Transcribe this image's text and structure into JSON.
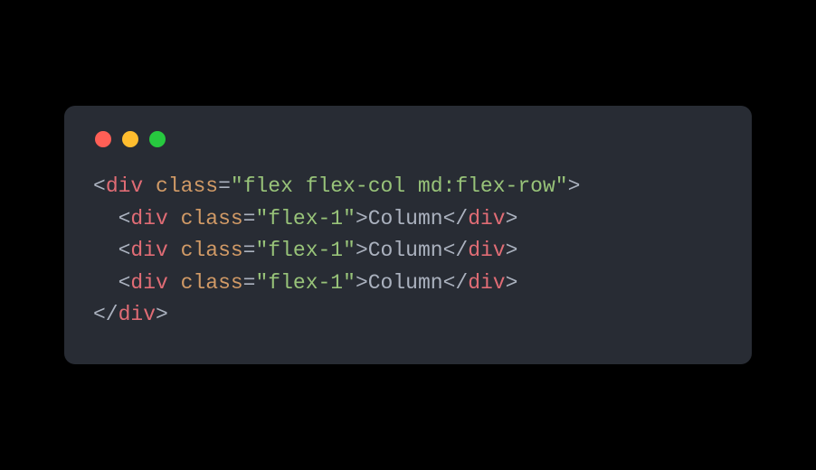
{
  "code": {
    "lines": [
      {
        "indent": "",
        "open": {
          "lt": "<",
          "tag": "div",
          "sp": " ",
          "attr": "class",
          "eq": "=",
          "q1": "\"",
          "val": "flex flex-col md:flex-row",
          "q2": "\"",
          "gt": ">"
        },
        "text": "",
        "close": null
      },
      {
        "indent": "  ",
        "open": {
          "lt": "<",
          "tag": "div",
          "sp": " ",
          "attr": "class",
          "eq": "=",
          "q1": "\"",
          "val": "flex-1",
          "q2": "\"",
          "gt": ">"
        },
        "text": "Column",
        "close": {
          "lt": "</",
          "tag": "div",
          "gt": ">"
        }
      },
      {
        "indent": "  ",
        "open": {
          "lt": "<",
          "tag": "div",
          "sp": " ",
          "attr": "class",
          "eq": "=",
          "q1": "\"",
          "val": "flex-1",
          "q2": "\"",
          "gt": ">"
        },
        "text": "Column",
        "close": {
          "lt": "</",
          "tag": "div",
          "gt": ">"
        }
      },
      {
        "indent": "  ",
        "open": {
          "lt": "<",
          "tag": "div",
          "sp": " ",
          "attr": "class",
          "eq": "=",
          "q1": "\"",
          "val": "flex-1",
          "q2": "\"",
          "gt": ">"
        },
        "text": "Column",
        "close": {
          "lt": "</",
          "tag": "div",
          "gt": ">"
        }
      },
      {
        "indent": "",
        "open": null,
        "text": "",
        "close": {
          "lt": "</",
          "tag": "div",
          "gt": ">"
        }
      }
    ]
  }
}
